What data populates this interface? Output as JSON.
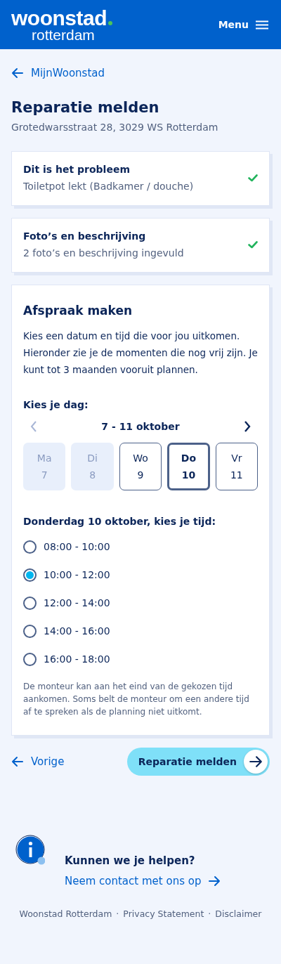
{
  "header": {
    "logo": {
      "line1": "woonstad",
      "line2": "rotterdam"
    },
    "menu_label": "Menu"
  },
  "back_link": "MijnWoonstad",
  "title": "Reparatie melden",
  "address": "Grotedwarsstraat 28, 3029 WS Rotterdam",
  "steps": [
    {
      "title": "Dit is het probleem",
      "summary": "Toiletpot lekt (Badkamer / douche)",
      "done": true
    },
    {
      "title": "Foto’s en beschrijving",
      "summary": "2 foto’s en beschrijving ingevuld",
      "done": true
    }
  ],
  "appointment": {
    "title": "Afspraak maken",
    "intro": "Kies een datum en tijd die voor jou uitkomen. Hieronder zie je de momenten die nog vrij zijn. Je kunt tot 3 maanden vooruit plannen.",
    "day_label": "Kies je dag:",
    "week": {
      "label": "7 - 11 oktober",
      "prev_disabled": true,
      "next_disabled": false
    },
    "days": [
      {
        "name": "Ma",
        "date": "7",
        "disabled": true,
        "selected": false
      },
      {
        "name": "Di",
        "date": "8",
        "disabled": true,
        "selected": false
      },
      {
        "name": "Wo",
        "date": "9",
        "disabled": false,
        "selected": false
      },
      {
        "name": "Do",
        "date": "10",
        "disabled": false,
        "selected": true
      },
      {
        "name": "Vr",
        "date": "11",
        "disabled": false,
        "selected": false
      }
    ],
    "time_label": "Donderdag 10 oktober, kies je tijd:",
    "times": [
      {
        "label": "08:00 - 10:00",
        "selected": false
      },
      {
        "label": "10:00 - 12:00",
        "selected": true
      },
      {
        "label": "12:00 - 14:00",
        "selected": false
      },
      {
        "label": "14:00 - 16:00",
        "selected": false
      },
      {
        "label": "16:00 - 18:00",
        "selected": false
      }
    ],
    "note": "De monteur kan aan het eind van de gekozen tijd aankomen. Soms belt de monteur om een andere tijd af te spreken als de planning niet uitkomt."
  },
  "nav": {
    "previous": "Vorige",
    "submit": "Reparatie melden"
  },
  "help": {
    "title": "Kunnen we je helpen?",
    "link": "Neem contact met ons op"
  },
  "footer": {
    "separator": "·",
    "links": [
      "Woonstad Rotterdam",
      "Privacy Statement",
      "Disclaimer"
    ]
  }
}
